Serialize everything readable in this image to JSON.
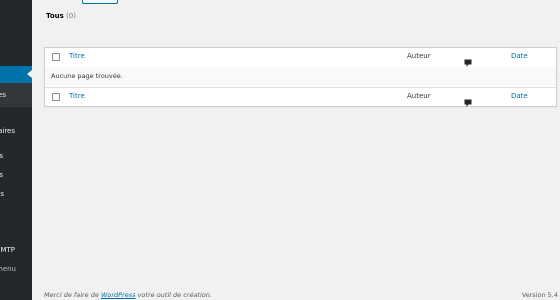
{
  "sidebar": {
    "items": [
      {
        "label": "es",
        "active": true
      },
      {
        "label": "aires"
      },
      {
        "label": "s"
      },
      {
        "label": "s"
      },
      {
        "label": "s"
      },
      {
        "label": "MTP"
      },
      {
        "label": "menu"
      }
    ]
  },
  "filter": {
    "all_label": "Tous",
    "all_count": "(0)"
  },
  "table": {
    "columns": {
      "title": "Titre",
      "author": "Auteur",
      "comments": "comment-bubble-icon",
      "date": "Date"
    },
    "empty_message": "Aucune page trouvée."
  },
  "footer": {
    "thanks_before": "Merci de faire de ",
    "thanks_link": "WordPress",
    "thanks_after": " votre outil de création.",
    "version": "Version 5.4"
  },
  "colors": {
    "sidebar_bg": "#23282d",
    "accent": "#0073aa",
    "page_bg": "#f1f1f1"
  }
}
